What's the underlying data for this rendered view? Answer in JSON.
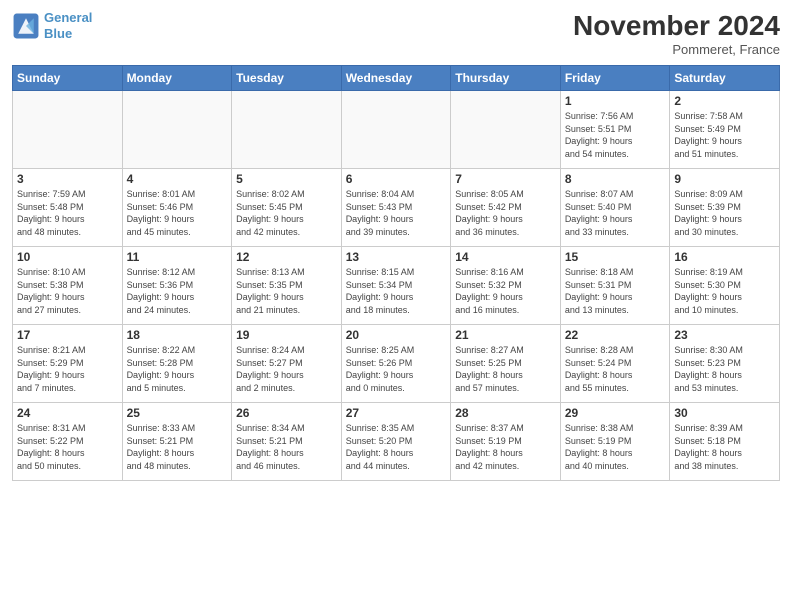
{
  "header": {
    "logo_line1": "General",
    "logo_line2": "Blue",
    "month_title": "November 2024",
    "location": "Pommeret, France"
  },
  "days_of_week": [
    "Sunday",
    "Monday",
    "Tuesday",
    "Wednesday",
    "Thursday",
    "Friday",
    "Saturday"
  ],
  "weeks": [
    [
      {
        "day": "",
        "info": ""
      },
      {
        "day": "",
        "info": ""
      },
      {
        "day": "",
        "info": ""
      },
      {
        "day": "",
        "info": ""
      },
      {
        "day": "",
        "info": ""
      },
      {
        "day": "1",
        "info": "Sunrise: 7:56 AM\nSunset: 5:51 PM\nDaylight: 9 hours\nand 54 minutes."
      },
      {
        "day": "2",
        "info": "Sunrise: 7:58 AM\nSunset: 5:49 PM\nDaylight: 9 hours\nand 51 minutes."
      }
    ],
    [
      {
        "day": "3",
        "info": "Sunrise: 7:59 AM\nSunset: 5:48 PM\nDaylight: 9 hours\nand 48 minutes."
      },
      {
        "day": "4",
        "info": "Sunrise: 8:01 AM\nSunset: 5:46 PM\nDaylight: 9 hours\nand 45 minutes."
      },
      {
        "day": "5",
        "info": "Sunrise: 8:02 AM\nSunset: 5:45 PM\nDaylight: 9 hours\nand 42 minutes."
      },
      {
        "day": "6",
        "info": "Sunrise: 8:04 AM\nSunset: 5:43 PM\nDaylight: 9 hours\nand 39 minutes."
      },
      {
        "day": "7",
        "info": "Sunrise: 8:05 AM\nSunset: 5:42 PM\nDaylight: 9 hours\nand 36 minutes."
      },
      {
        "day": "8",
        "info": "Sunrise: 8:07 AM\nSunset: 5:40 PM\nDaylight: 9 hours\nand 33 minutes."
      },
      {
        "day": "9",
        "info": "Sunrise: 8:09 AM\nSunset: 5:39 PM\nDaylight: 9 hours\nand 30 minutes."
      }
    ],
    [
      {
        "day": "10",
        "info": "Sunrise: 8:10 AM\nSunset: 5:38 PM\nDaylight: 9 hours\nand 27 minutes."
      },
      {
        "day": "11",
        "info": "Sunrise: 8:12 AM\nSunset: 5:36 PM\nDaylight: 9 hours\nand 24 minutes."
      },
      {
        "day": "12",
        "info": "Sunrise: 8:13 AM\nSunset: 5:35 PM\nDaylight: 9 hours\nand 21 minutes."
      },
      {
        "day": "13",
        "info": "Sunrise: 8:15 AM\nSunset: 5:34 PM\nDaylight: 9 hours\nand 18 minutes."
      },
      {
        "day": "14",
        "info": "Sunrise: 8:16 AM\nSunset: 5:32 PM\nDaylight: 9 hours\nand 16 minutes."
      },
      {
        "day": "15",
        "info": "Sunrise: 8:18 AM\nSunset: 5:31 PM\nDaylight: 9 hours\nand 13 minutes."
      },
      {
        "day": "16",
        "info": "Sunrise: 8:19 AM\nSunset: 5:30 PM\nDaylight: 9 hours\nand 10 minutes."
      }
    ],
    [
      {
        "day": "17",
        "info": "Sunrise: 8:21 AM\nSunset: 5:29 PM\nDaylight: 9 hours\nand 7 minutes."
      },
      {
        "day": "18",
        "info": "Sunrise: 8:22 AM\nSunset: 5:28 PM\nDaylight: 9 hours\nand 5 minutes."
      },
      {
        "day": "19",
        "info": "Sunrise: 8:24 AM\nSunset: 5:27 PM\nDaylight: 9 hours\nand 2 minutes."
      },
      {
        "day": "20",
        "info": "Sunrise: 8:25 AM\nSunset: 5:26 PM\nDaylight: 9 hours\nand 0 minutes."
      },
      {
        "day": "21",
        "info": "Sunrise: 8:27 AM\nSunset: 5:25 PM\nDaylight: 8 hours\nand 57 minutes."
      },
      {
        "day": "22",
        "info": "Sunrise: 8:28 AM\nSunset: 5:24 PM\nDaylight: 8 hours\nand 55 minutes."
      },
      {
        "day": "23",
        "info": "Sunrise: 8:30 AM\nSunset: 5:23 PM\nDaylight: 8 hours\nand 53 minutes."
      }
    ],
    [
      {
        "day": "24",
        "info": "Sunrise: 8:31 AM\nSunset: 5:22 PM\nDaylight: 8 hours\nand 50 minutes."
      },
      {
        "day": "25",
        "info": "Sunrise: 8:33 AM\nSunset: 5:21 PM\nDaylight: 8 hours\nand 48 minutes."
      },
      {
        "day": "26",
        "info": "Sunrise: 8:34 AM\nSunset: 5:21 PM\nDaylight: 8 hours\nand 46 minutes."
      },
      {
        "day": "27",
        "info": "Sunrise: 8:35 AM\nSunset: 5:20 PM\nDaylight: 8 hours\nand 44 minutes."
      },
      {
        "day": "28",
        "info": "Sunrise: 8:37 AM\nSunset: 5:19 PM\nDaylight: 8 hours\nand 42 minutes."
      },
      {
        "day": "29",
        "info": "Sunrise: 8:38 AM\nSunset: 5:19 PM\nDaylight: 8 hours\nand 40 minutes."
      },
      {
        "day": "30",
        "info": "Sunrise: 8:39 AM\nSunset: 5:18 PM\nDaylight: 8 hours\nand 38 minutes."
      }
    ]
  ]
}
